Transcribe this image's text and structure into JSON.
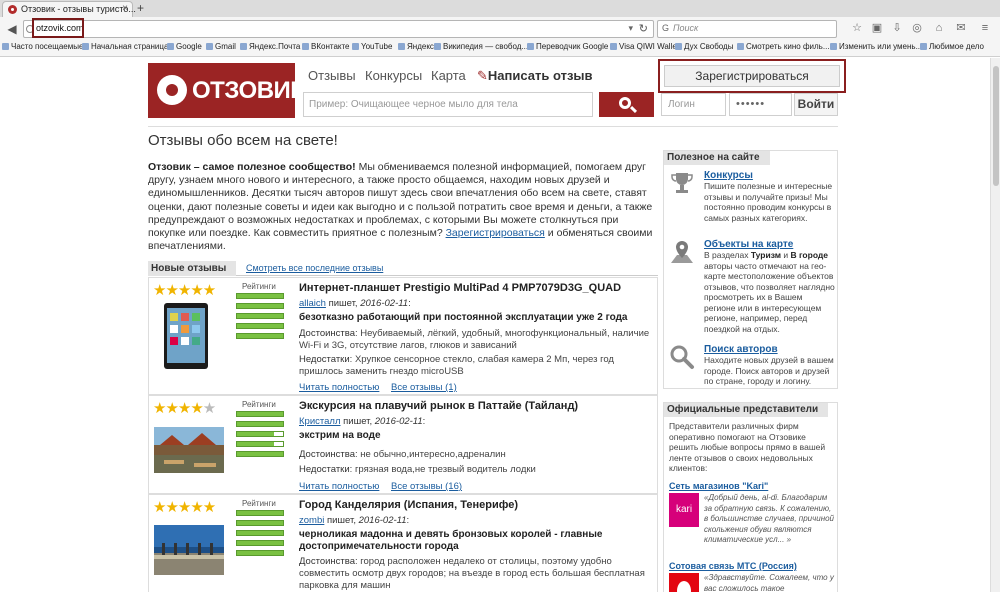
{
  "browser": {
    "tab_title": "Отзовик - отзывы туристо...",
    "url": "otzovik.com",
    "search_placeholder": "Поиск",
    "bookmarks": [
      "Часто посещаемые",
      "Начальная страница",
      "Google",
      "Gmail",
      "Яндекс.Почта",
      "ВКонтакте",
      "YouTube",
      "Яндекс",
      "Википедия — свобод...",
      "Переводчик Google",
      "Visa QIWI Wallet",
      "Дух Свободы",
      "Смотреть кино филь...",
      "Изменить или умень...",
      "Любимое дело"
    ]
  },
  "header": {
    "logo_text": "ОТЗОВИК",
    "nav": [
      "Отзывы",
      "Конкурсы",
      "Карта"
    ],
    "write_review": "Написать отзыв",
    "register": "Зарегистрироваться",
    "search_placeholder": "Пример: Очищающее черное мыло для тела",
    "login_placeholder": "Логин",
    "password_mask": "••••••",
    "login_button": "Войти"
  },
  "main": {
    "title": "Отзывы обо всем на свете!",
    "intro_bold": "Отзовик – самое полезное сообщество!",
    "intro_text": " Мы обмениваемся полезной информацией, помогаем друг другу, узнаем много нового и интересного, а также просто общаемся, находим новых друзей и единомышленников. Десятки тысяч авторов пишут здесь свои впечатления обо всем на свете, ставят оценки, дают полезные советы и идеи как выгодно и с пользой потратить свое время и деньги, а также предупреждают о возможных недостатках и проблемах, с которыми Вы можете столкнуться при покупке или поездке. Как совместить приятное с полезным? ",
    "intro_link": "Зарегистрироваться",
    "intro_tail": " и обменяться своими впечатлениями.",
    "reviews_tab": "Новые отзывы",
    "reviews_all": "Смотреть все последние отзывы",
    "ratings_label": "Рейтинги",
    "read_more": "Читать полностью",
    "wrote": "пишет,",
    "advantages_label": "Достоинства",
    "disadvantages_label": "Недостатки"
  },
  "reviews": [
    {
      "rating": 5,
      "title": "Интернет-планшет Prestigio MultiPad 4 PMP7079D3G_QUAD",
      "author": "allaich",
      "date": "2016-02-11",
      "summary": "безотказно работающий при постоянной эксплуатации уже 2 года",
      "advantages": "Неубиваемый, лёгкий, удобный, многофункциональный, наличие Wi-Fi и 3G, отсутствие лагов, глюков и зависаний",
      "disadvantages": "Хрупкое сенсорное стекло, слабая камера 2 Мп, через год пришлось заменить гнездо microUSB",
      "all_reviews": "Все отзывы (1)"
    },
    {
      "rating": 4.5,
      "title": "Экскурсия на плавучий рынок в Паттайе (Тайланд)",
      "author": "Кристалл",
      "date": "2016-02-11",
      "summary": "экстрим на воде",
      "advantages": "не обычно,интересно,адреналин",
      "disadvantages": "грязная вода,не трезвый водитель лодки",
      "all_reviews": "Все отзывы (16)"
    },
    {
      "rating": 5,
      "title": "Город Канделярия (Испания, Тенерифе)",
      "author": "zombi",
      "date": "2016-02-11",
      "summary": "черноликая мадонна и девять бронзовых королей - главные достопримечательности города",
      "advantages": "город расположен недалеко от столицы, поэтому удобно совместить осмотр двух городов; на въезде в город есть большая бесплатная парковка для машин",
      "disadvantages": "",
      "all_reviews": ""
    }
  ],
  "sidebar": {
    "useful_title": "Полезное на сайте",
    "items": [
      {
        "title": "Конкурсы",
        "desc": "Пишите полезные и интересные отзывы и получайте призы! Мы постоянно проводим конкурсы в самых разных категориях."
      },
      {
        "title": "Объекты на карте",
        "desc_pre": "В разделах ",
        "desc_b1": "Туризм",
        "desc_mid": " и ",
        "desc_b2": "В городе",
        "desc_post": " авторы часто отмечают на гео-карте местоположение объектов отзывов, что позволяет наглядно просмотреть их в Вашем регионе или в интересующем регионе, например, перед поездкой на отдых."
      },
      {
        "title": "Поиск авторов",
        "desc": "Находите новых друзей в вашем городе. Поиск авторов и друзей по стране, городу и логину."
      }
    ],
    "reps_title": "Официальные представители",
    "reps_intro": "Представители различных фирм оперативно помогают на Отзовике решить любые вопросы прямо в вашей ленте отзывов о своих недовольных клиентов:",
    "reps": [
      {
        "name": "Сеть магазинов \"Kari\"",
        "logo": "kari",
        "quote": "«Добрый день, al-di. Благодарим за обратную связь. К сожалению, в большинстве случаев, причиной скольжения обуви являются климатические усл... »"
      },
      {
        "name": "Сотовая связь МТС (Россия)",
        "logo": "",
        "quote": "«Здравствуйте. Сожалеем, что у вас сложилось такое впечатление о"
      }
    ]
  },
  "colors": {
    "brand": "#9b2424",
    "link": "#1a5c9e",
    "star": "#f0b400",
    "rating_bar": "#7ac142"
  }
}
